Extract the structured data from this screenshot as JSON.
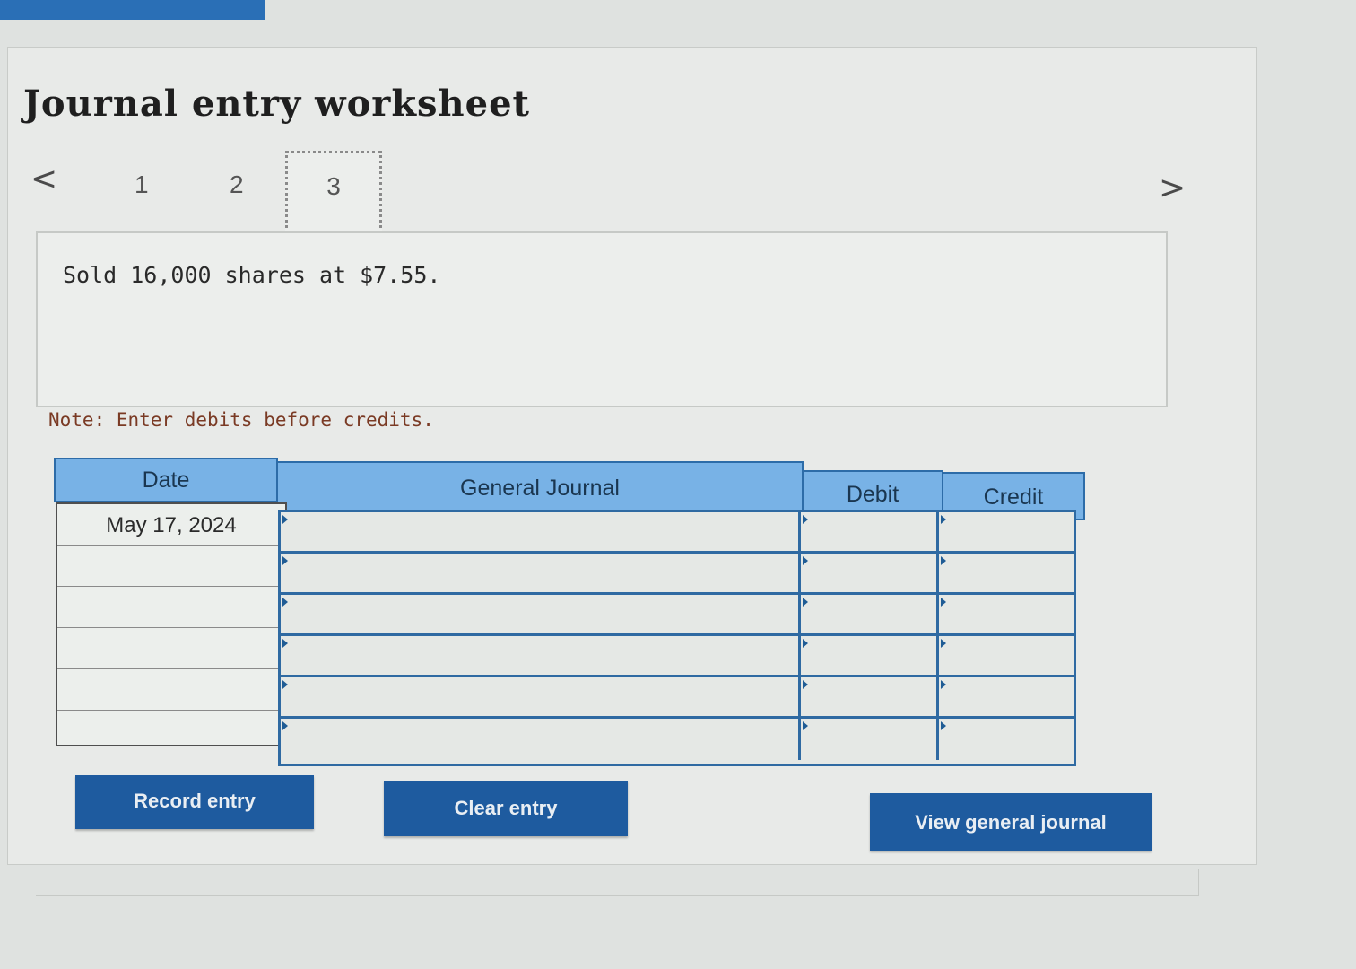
{
  "title": "Journal entry worksheet",
  "nav": {
    "prev": "<",
    "next": ">",
    "steps": [
      "1",
      "2",
      "3"
    ]
  },
  "transaction": {
    "description": "Sold 16,000 shares at $7.55."
  },
  "note": "Note: Enter debits before credits.",
  "journal": {
    "headers": {
      "date": "Date",
      "general_journal": "General Journal",
      "debit": "Debit",
      "credit": "Credit"
    },
    "rows": [
      {
        "date": "May 17, 2024",
        "account": "",
        "debit": "",
        "credit": ""
      },
      {
        "date": "",
        "account": "",
        "debit": "",
        "credit": ""
      },
      {
        "date": "",
        "account": "",
        "debit": "",
        "credit": ""
      },
      {
        "date": "",
        "account": "",
        "debit": "",
        "credit": ""
      },
      {
        "date": "",
        "account": "",
        "debit": "",
        "credit": ""
      },
      {
        "date": "",
        "account": "",
        "debit": "",
        "credit": ""
      }
    ]
  },
  "buttons": {
    "record": "Record entry",
    "clear": "Clear entry",
    "view": "View general journal"
  },
  "colors": {
    "accent": "#1e5b9f",
    "header_bg": "#78b2e6",
    "grid_border": "#2f6aa2",
    "note": "#7a3a24"
  }
}
